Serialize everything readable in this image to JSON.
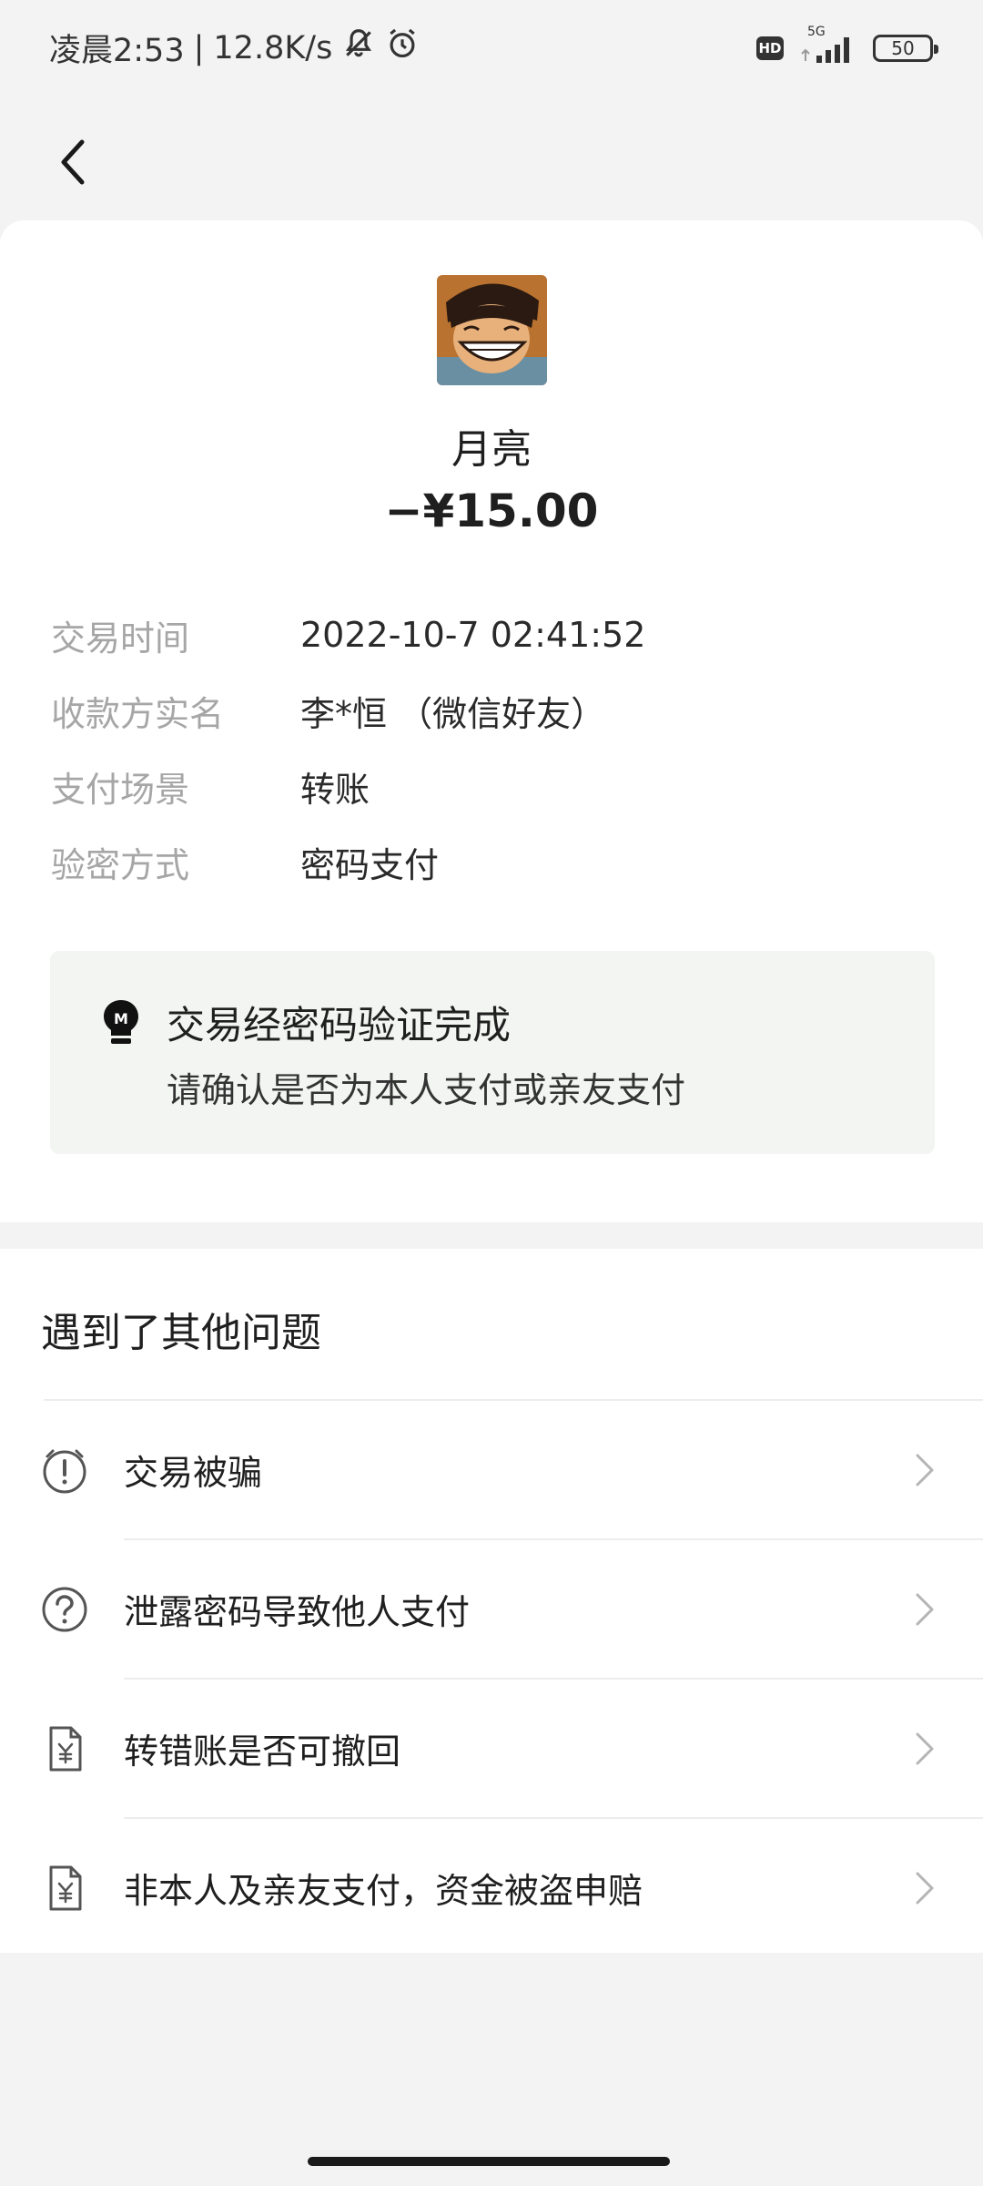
{
  "status_bar": {
    "time": "凌晨2:53",
    "separator": "|",
    "net_speed": "12.8K/s",
    "hd": "HD",
    "network": "5G",
    "battery": "50"
  },
  "payee": {
    "name": "月亮",
    "amount": "−¥15.00"
  },
  "details": [
    {
      "label": "交易时间",
      "value": "2022-10-7 02:41:52"
    },
    {
      "label": "收款方实名",
      "value": "李*恒 （微信好友）"
    },
    {
      "label": "支付场景",
      "value": "转账"
    },
    {
      "label": "验密方式",
      "value": "密码支付"
    }
  ],
  "notice": {
    "title": "交易经密码验证完成",
    "subtitle": "请确认是否为本人支付或亲友支付"
  },
  "issues": {
    "title": "遇到了其他问题",
    "items": [
      {
        "label": "交易被骗",
        "icon": "alert-clock-icon"
      },
      {
        "label": "泄露密码导致他人支付",
        "icon": "question-circle-icon"
      },
      {
        "label": "转错账是否可撤回",
        "icon": "yuan-doc-icon"
      },
      {
        "label": "非本人及亲友支付，资金被盗申赔",
        "icon": "yuan-doc-icon"
      }
    ]
  },
  "colors": {
    "background": "#f3f3f3",
    "card": "#ffffff",
    "label_gray": "#a6a6a6",
    "notice_bg": "#f2f5f2"
  }
}
